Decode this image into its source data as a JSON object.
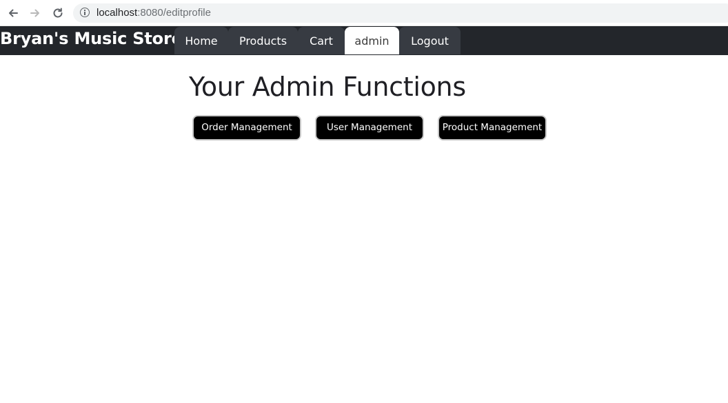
{
  "browser": {
    "url_host": "localhost",
    "url_rest": ":8080/editprofile"
  },
  "site": {
    "brand": "Bryan's Music Store",
    "nav": [
      {
        "label": "Home",
        "active": false
      },
      {
        "label": "Products",
        "active": false
      },
      {
        "label": "Cart",
        "active": false
      },
      {
        "label": "admin",
        "active": true
      },
      {
        "label": "Logout",
        "active": false
      }
    ]
  },
  "main": {
    "title": "Your Admin Functions",
    "buttons": [
      {
        "label": "Order Management"
      },
      {
        "label": "User Management"
      },
      {
        "label": "Product Management"
      }
    ]
  },
  "colors": {
    "navbar_bg": "#23262b",
    "tab_bg": "#373b42",
    "button_bg": "#000000"
  }
}
